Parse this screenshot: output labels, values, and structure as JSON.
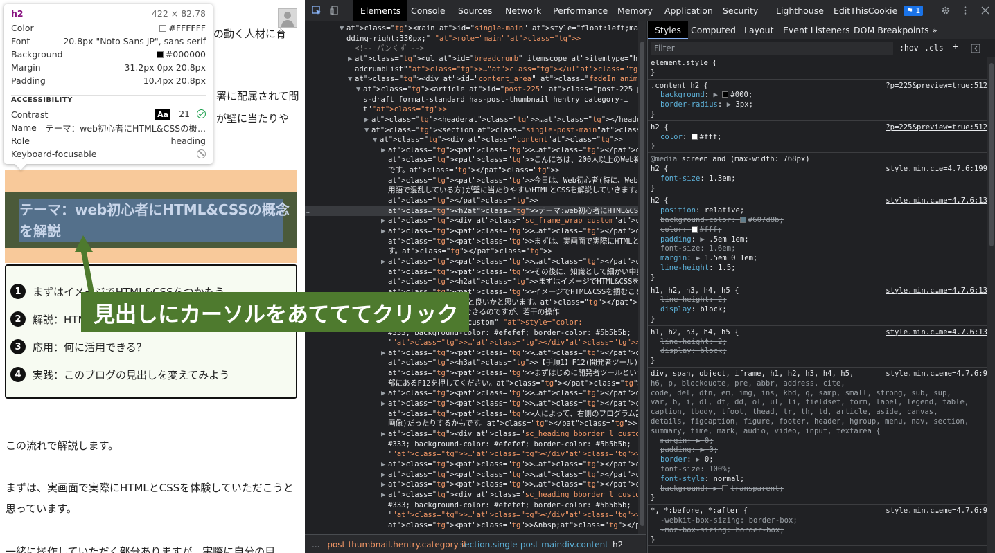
{
  "tooltip": {
    "tag": "h2",
    "dims": "422 × 82.78",
    "rows": [
      {
        "k": "Color",
        "v": "#FFFFFF"
      },
      {
        "k": "Font",
        "v": "20.8px \"Noto Sans JP\", sans-serif"
      },
      {
        "k": "Background",
        "v": "#000000"
      },
      {
        "k": "Margin",
        "v": "31.2px 0px 20.8px"
      },
      {
        "k": "Padding",
        "v": "10.4px 20.8px"
      }
    ],
    "section": "ACCESSIBILITY",
    "a11y": [
      {
        "k": "Contrast",
        "aa": "Aa",
        "v": "21"
      },
      {
        "k": "Name",
        "v": "テーマ：web初心者にHTML&CSSの概..."
      },
      {
        "k": "Role",
        "v": "heading"
      },
      {
        "k": "Keyboard-focusable",
        "v": ""
      }
    ],
    "colors": {
      "fg": "#FFFFFF",
      "bg": "#000000"
    }
  },
  "page": {
    "peek_texts": [
      "の動く人材に育",
      "署に配属されて間",
      "が壁に当たりや"
    ],
    "heading": "テーマ：web初心者にHTML&CSSの概念を解説",
    "toc": [
      {
        "num": "1",
        "text": "まずはイメージでHTML&CSSをつかもう"
      },
      {
        "num": "2",
        "text": "解説：HTML&CSSとは？"
      },
      {
        "num": "3",
        "text": "応用：何に活用できる？"
      },
      {
        "num": "4",
        "text": "実践：このブログの見出しを変えてみよう"
      }
    ],
    "paragraphs": [
      "この流れで解説します。",
      "まずは、実画面で実際にHTMLとCSSを体験していただこうと思っています。",
      "一緒に操作していただく部分ありますが、実際に自分の目"
    ]
  },
  "annotation": {
    "text": "見出しにカーソルをあてててクリック"
  },
  "devtools": {
    "tabs": [
      "Elements",
      "Console",
      "Sources",
      "Network",
      "Performance",
      "Memory",
      "Application",
      "Security",
      "Lighthouse",
      "EditThisCookie"
    ],
    "issues_count": "1",
    "breadcrumb": [
      "...",
      "-post-thumbnail.hentry.category-it",
      "section.single-post-main",
      "div.content",
      "h2"
    ],
    "dom_lines": [
      {
        "i": 4,
        "t": "▼",
        "h": "<main id=\"single-main\" style=\"float:left;margin-right:-330px;pa"
      },
      {
        "i": 4,
        "t": "",
        "h": "dding-right:330px;\" role=\"main\">"
      },
      {
        "i": 5,
        "t": "",
        "h": "<!-- パンくず -->",
        "c": true
      },
      {
        "i": 5,
        "t": "▶",
        "h": "<ul id=\"breadcrumb\" itemscope itemtype=\"http://schema.org/Bre"
      },
      {
        "i": 5,
        "t": "",
        "h": "adcrumbList\">…</ul>"
      },
      {
        "i": 5,
        "t": "▼",
        "h": "<div id=\"content_area\" class=\"fadeIn animated\">"
      },
      {
        "i": 6,
        "t": "▼",
        "h": "<article id=\"post-225\" class=\"post-225 post type-post statu"
      },
      {
        "i": 6,
        "t": "",
        "h": "s-draft format-standard has-post-thumbnail hentry category-i"
      },
      {
        "i": 6,
        "t": "",
        "h": "t\">"
      },
      {
        "i": 7,
        "t": "▶",
        "h": "<header>…</header>"
      },
      {
        "i": 7,
        "t": "▼",
        "h": "<section class=\"single-post-main\">"
      },
      {
        "i": 8,
        "t": "▼",
        "h": "<div class=\"content\">"
      },
      {
        "i": 9,
        "t": "▶",
        "h": "<p>…</p>"
      },
      {
        "i": 9,
        "t": "",
        "h": "<p>こんにちは、200人以上のWeb初心者を手の動く人材に育ててきたうみん"
      },
      {
        "i": 9,
        "t": "",
        "h": "です。</p>"
      },
      {
        "i": 9,
        "t": "",
        "h": "<p>今日は、Web初心者(特に、Web担当部署に配属されて間もない、カタカナ"
      },
      {
        "i": 9,
        "t": "",
        "h": "用語で混乱している方)が壁に当たりやすいHTMLとCSSを解説していきます。"
      },
      {
        "i": 9,
        "t": "",
        "h": "</p>"
      },
      {
        "i": 9,
        "t": "",
        "h": "<h2>テーマ:web初心者にHTML&CSSの概念を解説</h2> == $0",
        "sel": true
      },
      {
        "i": 9,
        "t": "▶",
        "h": "<div class=\"sc_frame_wrap  custom\">…</div>"
      },
      {
        "i": 9,
        "t": "▶",
        "h": "<p>…</p>"
      },
      {
        "i": 9,
        "t": "",
        "h": "<p>まずは、実画面で実際にHTMLとCSSを体験していただこうと思っていま"
      },
      {
        "i": 9,
        "t": "",
        "h": "す。</p>"
      },
      {
        "i": 9,
        "t": "▶",
        "h": "<p>…</p>"
      },
      {
        "i": 9,
        "t": "",
        "h": "<p>その後に、知識として細かい中身を解説していきます。</p>"
      },
      {
        "i": 9,
        "t": "",
        "h": "<h2>まずはイメージでHTML&CSSをつかもう</h2>"
      },
      {
        "i": 9,
        "t": "",
        "h": "<p>イメージでHTML&CSSを掴むことをやっていくのですが、事前にこのページ"
      },
      {
        "i": 9,
        "t": "",
        "h": "は開いておいてもらえると良いかと思います。</p>"
      },
      {
        "i": 9,
        "t": "",
        "h": "Edgeでも同様のことができるのですが、若干の操作"
      },
      {
        "i": 9,
        "t": "",
        "h": "heading bborder l custom\" style=\"color:"
      },
      {
        "i": 9,
        "t": "",
        "h": "#333; background-color: #efefef; border-color: #5b5b5b;"
      },
      {
        "i": 9,
        "t": "",
        "h": "\">…</div>"
      },
      {
        "i": 9,
        "t": "▶",
        "h": "<p>…</p>"
      },
      {
        "i": 9,
        "t": "",
        "h": "<h3>【手順1】F12(開発者ツール)を起動しましょう</h3>"
      },
      {
        "i": 9,
        "t": "",
        "h": "<p>まずはじめに開発者ツールという機能を起動させるため、キーボードの上"
      },
      {
        "i": 9,
        "t": "",
        "h": "部にあるF12を押してください。</p>"
      },
      {
        "i": 9,
        "t": "▶",
        "h": "<p>…</p>"
      },
      {
        "i": 9,
        "t": "▶",
        "h": "<p>…</p>"
      },
      {
        "i": 9,
        "t": "",
        "h": "<p>人によって、右側のプログラム部分が上下に分かれていたり、左右(上記"
      },
      {
        "i": 9,
        "t": "",
        "h": "画像)だったりするかもです。</p>"
      },
      {
        "i": 9,
        "t": "▶",
        "h": "<div class=\"sc_heading bborder l custom\" style=\"color:"
      },
      {
        "i": 9,
        "t": "",
        "h": "#333; background-color: #efefef; border-color: #5b5b5b;"
      },
      {
        "i": 9,
        "t": "",
        "h": "\">…</div>"
      },
      {
        "i": 9,
        "t": "▶",
        "h": "<p>…</p>"
      },
      {
        "i": 9,
        "t": "▶",
        "h": "<p>…</p>"
      },
      {
        "i": 9,
        "t": "▶",
        "h": "<p>…</p>"
      },
      {
        "i": 9,
        "t": "▶",
        "h": "<div class=\"sc_heading bborder l custom\" style=\"color:"
      },
      {
        "i": 9,
        "t": "",
        "h": "#333; background-color: #efefef; border-color: #5b5b5b;"
      },
      {
        "i": 9,
        "t": "",
        "h": "\">…</div>"
      },
      {
        "i": 9,
        "t": "",
        "h": "<p>&nbsp;</p>"
      }
    ],
    "styles_tabs": [
      "Styles",
      "Computed",
      "Layout",
      "Event Listeners",
      "DOM Breakpoints",
      "»"
    ],
    "filter_placeholder": "Filter",
    "hov": ":hov",
    "cls": ".cls",
    "rules": [
      {
        "sel": "element.style {",
        "src": "",
        "props": []
      },
      {
        "sel": ".content h2 {",
        "src": "?p=225&preview=true:512",
        "props": [
          {
            "n": "background",
            "v": "#000",
            "sw": "#000000",
            "arrow": true
          },
          {
            "n": "border-radius",
            "v": "3px",
            "arrow": true
          }
        ]
      },
      {
        "sel": "h2 {",
        "src": "?p=225&preview=true:512",
        "props": [
          {
            "n": "color",
            "v": "#fff",
            "sw": "#ffffff"
          }
        ]
      },
      {
        "sel": "h2 {",
        "media": "@media screen and (max-width: 768px)",
        "src": "style.min.c…e=4.7.6:199",
        "props": [
          {
            "n": "font-size",
            "v": "1.3em"
          }
        ]
      },
      {
        "sel": "h2 {",
        "src": "style.min.c…me=4.7.6:13",
        "props": [
          {
            "n": "position",
            "v": "relative"
          },
          {
            "n": "background-color",
            "v": "#607d8b",
            "sw": "#607d8b",
            "s": true
          },
          {
            "n": "color",
            "v": "#fff",
            "sw": "#ffffff",
            "s": true
          },
          {
            "n": "padding",
            "v": ".5em 1em",
            "arrow": true
          },
          {
            "n": "font-size",
            "v": "1.6em",
            "s": true
          },
          {
            "n": "margin",
            "v": "1.5em 0 1em",
            "arrow": true
          },
          {
            "n": "line-height",
            "v": "1.5"
          }
        ]
      },
      {
        "sel": "h1, h2, h3, h4, h5 {",
        "src": "style.min.c…me=4.7.6:13",
        "props": [
          {
            "n": "line-height",
            "v": "2",
            "s": true
          },
          {
            "n": "display",
            "v": "block"
          }
        ]
      },
      {
        "sel": "h1, h2, h3, h4, h5 {",
        "src": "style.min.c…me=4.7.6:13",
        "props": [
          {
            "n": "line-height",
            "v": "2",
            "s": true
          },
          {
            "n": "display",
            "v": "block",
            "s": true
          }
        ]
      },
      {
        "sel": "div, span, object, iframe, h1, h2, h3, h4, h5,",
        "extra": [
          "h6, p, blockquote, pre, abbr, address, cite,",
          "code, del, dfn, em, img, ins, kbd, q, samp, small, strong, sub, sup,",
          "var, b, i, dl, dt, dd, ol, ul, li, fieldset, form, label, legend, table,",
          "caption, tbody, tfoot, thead, tr, th, td, article, aside, canvas,",
          "details, figcaption, figure, footer, header, hgroup, menu, nav, section,",
          "summary, time, mark, audio, video, input, textarea {"
        ],
        "src": "style.min.c…eme=4.7.6:9",
        "props": [
          {
            "n": "margin",
            "v": "0",
            "arrow": true,
            "s": true
          },
          {
            "n": "padding",
            "v": "0",
            "arrow": true,
            "s": true
          },
          {
            "n": "border",
            "v": "0",
            "arrow": true
          },
          {
            "n": "font-size",
            "v": "100%",
            "s": true
          },
          {
            "n": "font-style",
            "v": "normal"
          },
          {
            "n": "background",
            "v": "transparent",
            "sw": "transparent",
            "arrow": true,
            "s": true
          }
        ]
      },
      {
        "sel": "*, *:before, *:after {",
        "src": "style.min.c…eme=4.7.6:9",
        "props": [
          {
            "n": "-webkit-box-sizing",
            "v": "border-box",
            "s": true
          },
          {
            "n": "-moz-box-sizing",
            "v": "border-box",
            "s": true
          }
        ]
      }
    ]
  }
}
